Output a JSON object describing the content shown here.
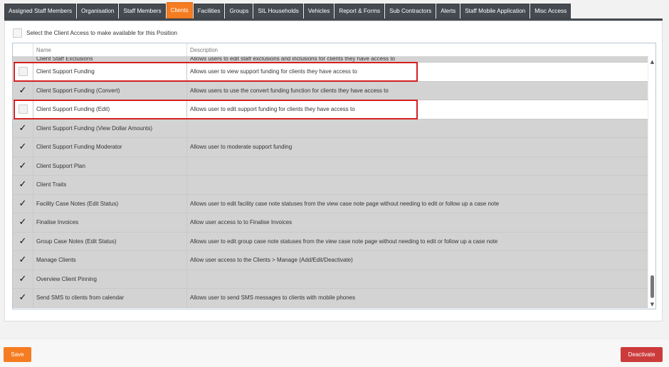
{
  "tabs": [
    {
      "label": "Assigned Staff Members",
      "active": false
    },
    {
      "label": "Organisation",
      "active": false
    },
    {
      "label": "Staff Members",
      "active": false
    },
    {
      "label": "Clients",
      "active": true
    },
    {
      "label": "Facilities",
      "active": false
    },
    {
      "label": "Groups",
      "active": false
    },
    {
      "label": "SIL Households",
      "active": false
    },
    {
      "label": "Vehicles",
      "active": false
    },
    {
      "label": "Report & Forms",
      "active": false
    },
    {
      "label": "Sub Contractors",
      "active": false
    },
    {
      "label": "Alerts",
      "active": false
    },
    {
      "label": "Staff Mobile Application",
      "active": false
    },
    {
      "label": "Misc Access",
      "active": false
    }
  ],
  "select_all_label": "Select the Client Access to make available for this Position",
  "grid": {
    "col_name": "Name",
    "col_desc": "Description",
    "rows": [
      {
        "name": "Client Staff Exclusions",
        "desc": "Allows users to edit staff exclusions and inclusions for clients they have access to",
        "checked": true,
        "partial": true
      },
      {
        "name": "Client Support Funding",
        "desc": "Allows user to view support funding for clients they have access to",
        "checked": false,
        "highlight": true
      },
      {
        "name": "Client Support Funding (Convert)",
        "desc": "Allows users to use the convert funding function for clients they have access to",
        "checked": true
      },
      {
        "name": "Client Support Funding (Edit)",
        "desc": "Allows user to edit support funding for clients they have access to",
        "checked": false,
        "highlight": true
      },
      {
        "name": "Client Support Funding (View Dollar Amounts)",
        "desc": "",
        "checked": true
      },
      {
        "name": "Client Support Funding Moderator",
        "desc": "Allows user to moderate support funding",
        "checked": true
      },
      {
        "name": "Client Support Plan",
        "desc": "",
        "checked": true
      },
      {
        "name": "Client Traits",
        "desc": "",
        "checked": true
      },
      {
        "name": "Facility Case Notes (Edit Status)",
        "desc": "Allows user to edit facility case note statuses from the view case note page without needing to edit or follow up a case note",
        "checked": true
      },
      {
        "name": "Finalise Invoices",
        "desc": "Allow user access to to Finalise Invoices",
        "checked": true
      },
      {
        "name": "Group Case Notes (Edit Status)",
        "desc": "Allows user to edit group case note statuses from the view case note page without needing to edit or follow up a case note",
        "checked": true
      },
      {
        "name": "Manage Clients",
        "desc": "Allow user access to the Clients > Manage (Add/Edit/Deactivate)",
        "checked": true
      },
      {
        "name": "Overview Client Pinning",
        "desc": "",
        "checked": true
      },
      {
        "name": "Send SMS to clients from calendar",
        "desc": "Allows user to send SMS messages to clients with mobile phones",
        "checked": true
      }
    ]
  },
  "buttons": {
    "save": "Save",
    "deactivate": "Deactivate"
  },
  "colors": {
    "accent": "#f57c21",
    "tab_bg": "#444a50",
    "danger": "#cc3b3b",
    "highlight": "#d61f1f"
  },
  "icons": {
    "check": "check-icon",
    "scroll_up": "chevron-up-icon",
    "scroll_down": "chevron-down-icon"
  }
}
